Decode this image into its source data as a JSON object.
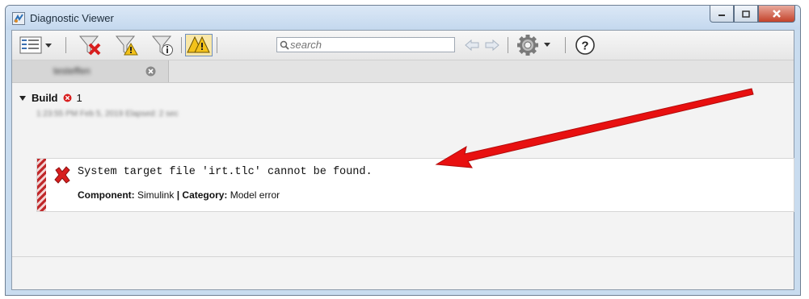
{
  "window": {
    "title": "Diagnostic Viewer"
  },
  "toolbar": {
    "search_placeholder": "search",
    "icons": [
      "view-options-icon",
      "filter-errors-icon",
      "filter-warnings-icon",
      "filter-info-icon",
      "highlight-warnings-icon",
      "search-icon",
      "back-arrow-icon",
      "forward-arrow-icon",
      "settings-gear-icon",
      "help-icon"
    ]
  },
  "tab": {
    "label": "testeffen"
  },
  "build": {
    "label": "Build",
    "error_count": "1",
    "timestamp": "1:23:55 PM Feb 5, 2019   Elapsed: 2 sec"
  },
  "message": {
    "text": "System target file 'irt.tlc' cannot be found.",
    "component_label": "Component:",
    "component_value": "Simulink",
    "separator": "|",
    "category_label": "Category:",
    "category_value": "Model error"
  },
  "colors": {
    "error": "#d81e1e",
    "annotation_arrow": "#e81010"
  }
}
